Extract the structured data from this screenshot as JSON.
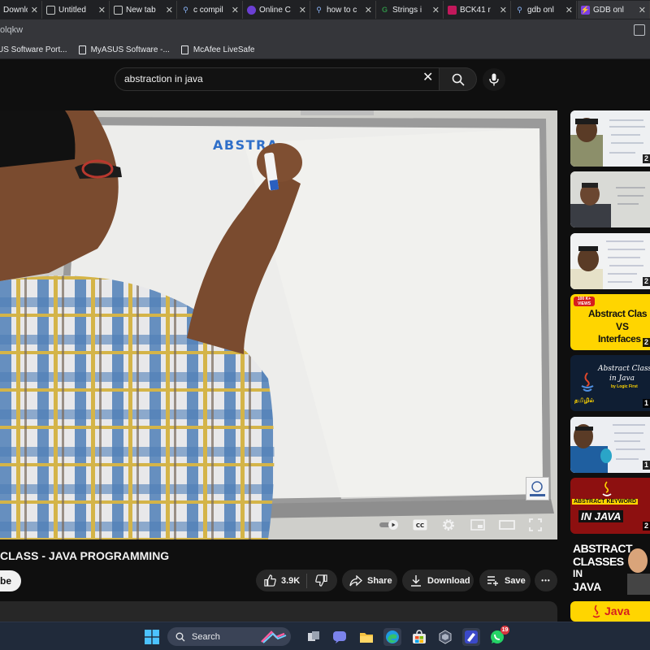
{
  "browser": {
    "tabs": [
      {
        "label": "Downlo",
        "icon": "download-page-icon"
      },
      {
        "label": "Untitled",
        "icon": "document-icon"
      },
      {
        "label": "New tab",
        "icon": "new-tab-icon"
      },
      {
        "label": "c compil",
        "icon": "search-icon"
      },
      {
        "label": "Online C",
        "icon": "compiler-icon"
      },
      {
        "label": "how to c",
        "icon": "search-icon"
      },
      {
        "label": "Strings i",
        "icon": "geeks-icon"
      },
      {
        "label": "BCK41 r",
        "icon": "app-icon"
      },
      {
        "label": "gdb onl",
        "icon": "search-icon"
      },
      {
        "label": "GDB onl",
        "icon": "gdb-icon"
      }
    ],
    "address_text": "olqkw",
    "bookmarks": [
      {
        "label": "US Software Port..."
      },
      {
        "label": "MyASUS Software -..."
      },
      {
        "label": "McAfee LiveSafe"
      }
    ]
  },
  "search": {
    "query": "abstraction in java"
  },
  "video": {
    "board_text": "ABSTRA",
    "title": "CLASS - JAVA PROGRAMMING",
    "subscribe_label": "ibe",
    "likes": "3.9K",
    "share_label": "Share",
    "download_label": "Download",
    "save_label": "Save",
    "more_label": "•••"
  },
  "sidebar": {
    "thumbnails": [
      {
        "duration": "2"
      },
      {
        "duration": ""
      },
      {
        "duration": "2"
      },
      {
        "badge_top": "100 K+",
        "badge_bottom": "VIEWS",
        "line1": "Abstract Clas",
        "line2": "VS",
        "line3": "Interfaces",
        "duration": "2"
      },
      {
        "line1": "Abstract Classes",
        "line2": "in Java",
        "line3": "by Logic First",
        "tag": "தமிழில்",
        "duration": "1"
      },
      {
        "duration": "1"
      },
      {
        "line1": "ABSTRACT KEYWORD",
        "line2": "IN JAVA",
        "duration": "2"
      },
      {
        "line1": "ABSTRACT",
        "line2": "CLASSES",
        "line3": "IN",
        "line4": "JAVA"
      },
      {
        "line1": "Java"
      }
    ]
  },
  "taskbar": {
    "search_label": "Search",
    "whatsapp_badge": "19"
  },
  "colors": {
    "background": "#0f0f0f",
    "pill": "#272727",
    "taskbar": "#202a3a",
    "thumb_yellow": "#ffd500",
    "keyword_red": "#d61e1e"
  }
}
